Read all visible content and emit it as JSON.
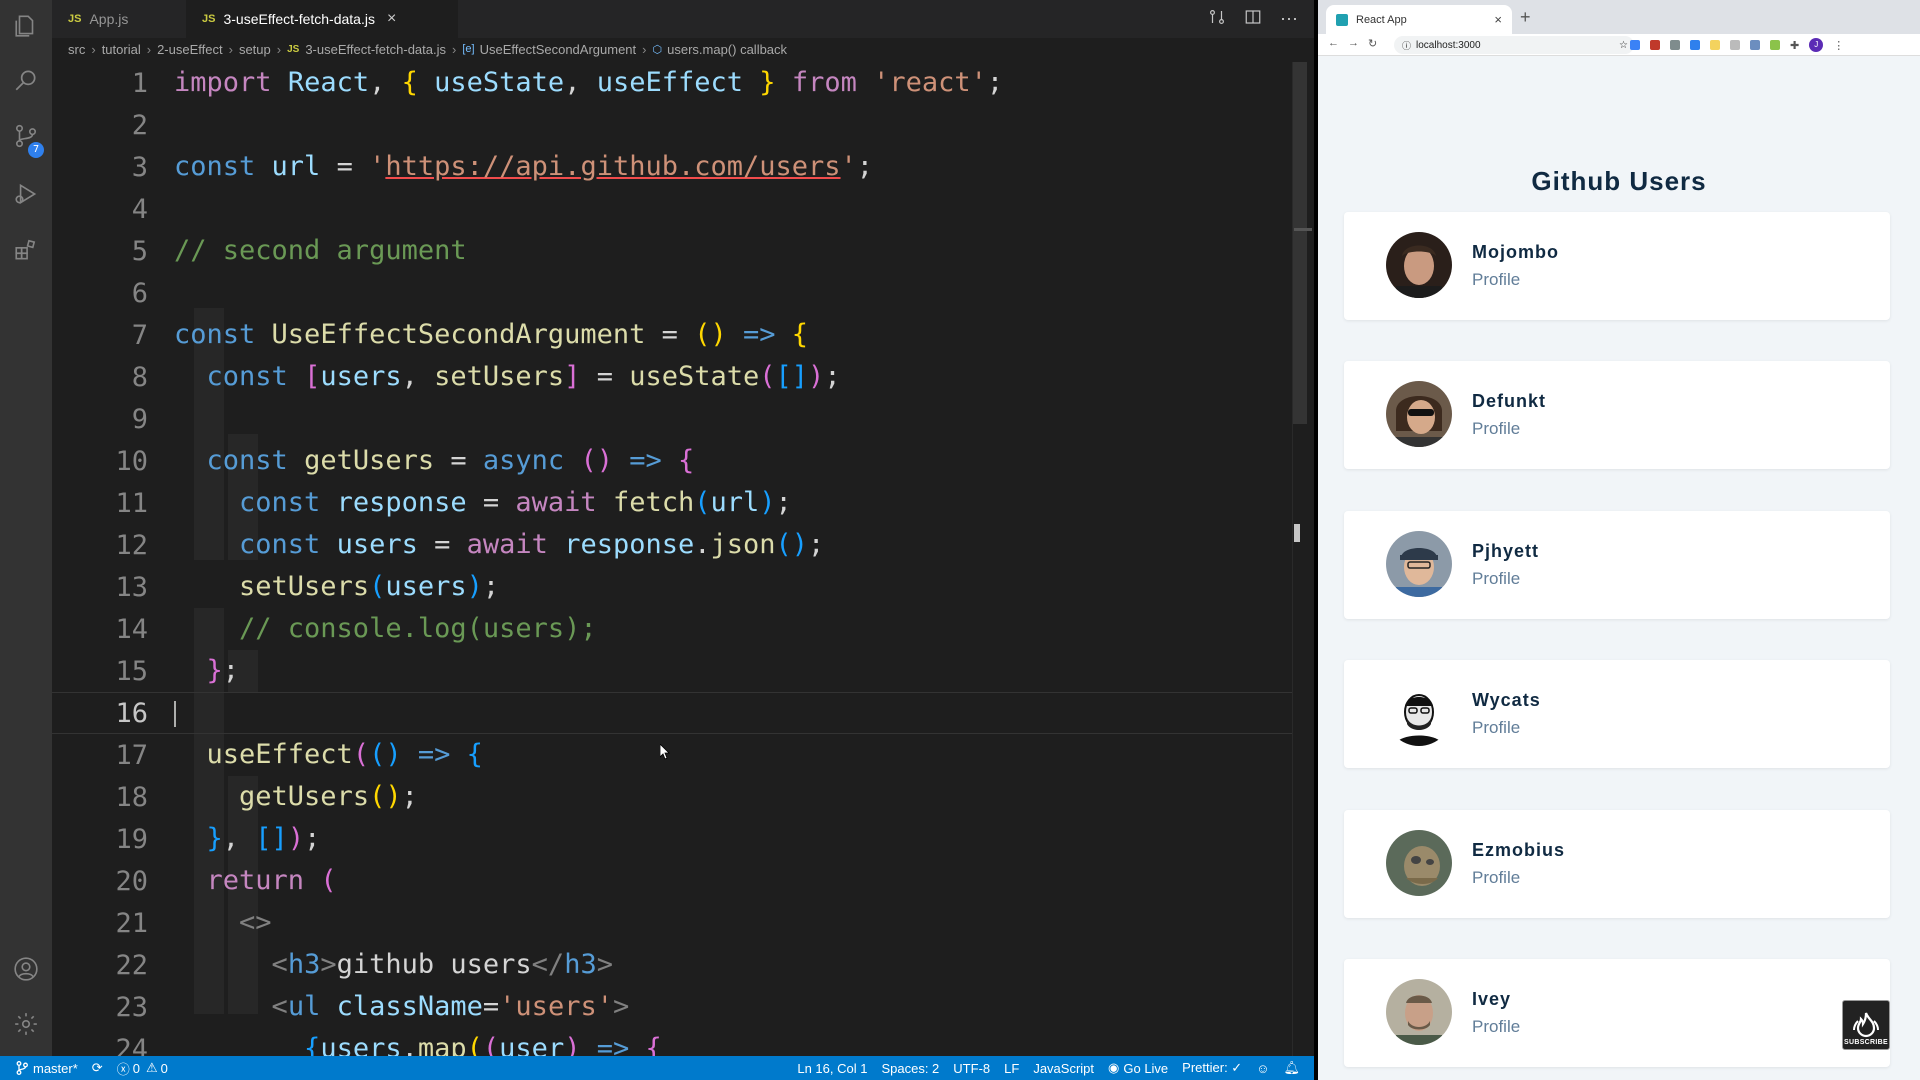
{
  "editor": {
    "tabs": [
      {
        "label": "App.js",
        "badge": "JS"
      },
      {
        "label": "3-useEffect-fetch-data.js",
        "badge": "JS",
        "close": "×"
      }
    ],
    "breadcrumb": [
      "src",
      "tutorial",
      "2-useEffect",
      "setup",
      "3-useEffect-fetch-data.js",
      "UseEffectSecondArgument",
      "users.map() callback"
    ],
    "breadcrumb_file_badge": "JS",
    "activity_badge": "7",
    "line_numbers": [
      "1",
      "2",
      "3",
      "4",
      "5",
      "6",
      "7",
      "8",
      "9",
      "10",
      "11",
      "12",
      "13",
      "14",
      "15",
      "16",
      "17",
      "18",
      "19",
      "20",
      "21",
      "22",
      "23",
      "24"
    ]
  },
  "status_bar": {
    "branch": "master*",
    "errors": "0",
    "warnings": "0",
    "position": "Ln 16, Col 1",
    "spaces": "Spaces: 2",
    "encoding": "UTF-8",
    "eol": "LF",
    "language": "JavaScript",
    "go_live": "Go Live",
    "prettier": "Prettier: ✓"
  },
  "browser": {
    "tab_title": "React App",
    "new_tab": "+",
    "close": "×",
    "url": "localhost:3000",
    "page_title": "Github Users",
    "users": [
      {
        "name": "Mojombo",
        "link": "Profile"
      },
      {
        "name": "Defunkt",
        "link": "Profile"
      },
      {
        "name": "Pjhyett",
        "link": "Profile"
      },
      {
        "name": "Wycats",
        "link": "Profile"
      },
      {
        "name": "Ezmobius",
        "link": "Profile"
      },
      {
        "name": "Ivey",
        "link": "Profile"
      }
    ]
  },
  "overlay": {
    "subscribe": "SUBSCRIBE"
  },
  "colors": {
    "status_bar": "#007acc",
    "editor_bg": "#1e1e1e",
    "page_bg": "#f1f5f8",
    "heading": "#102a42"
  }
}
